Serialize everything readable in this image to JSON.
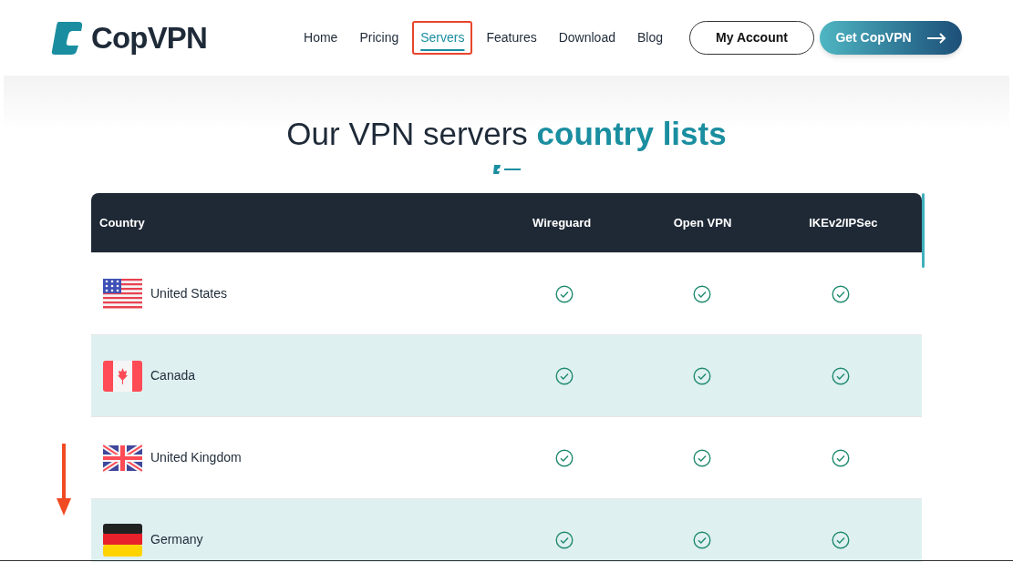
{
  "logo": {
    "text": "CopVPN"
  },
  "nav": [
    {
      "label": "Home",
      "selected": false,
      "highlighted": false
    },
    {
      "label": "Pricing",
      "selected": false,
      "highlighted": false
    },
    {
      "label": "Servers",
      "selected": true,
      "highlighted": true
    },
    {
      "label": "Features",
      "selected": false,
      "highlighted": false
    },
    {
      "label": "Download",
      "selected": false,
      "highlighted": false
    },
    {
      "label": "Blog",
      "selected": false,
      "highlighted": false
    }
  ],
  "account_button": "My Account",
  "cta_button": "Get CopVPN",
  "heading": {
    "plain": "Our VPN servers",
    "accent": "country lists"
  },
  "table": {
    "columns": [
      "Country",
      "Wireguard",
      "Open VPN",
      "IKEv2/IPSec"
    ],
    "rows": [
      {
        "country": "United States",
        "kind": "us",
        "supported": [
          true,
          true,
          true
        ]
      },
      {
        "country": "Canada",
        "kind": "ca",
        "supported": [
          true,
          true,
          true
        ]
      },
      {
        "country": "United Kingdom",
        "kind": "uk",
        "supported": [
          true,
          true,
          true
        ]
      },
      {
        "country": "Germany",
        "kind": "de",
        "supported": [
          true,
          true,
          true
        ]
      }
    ]
  },
  "scroll_hint_arrow": true
}
